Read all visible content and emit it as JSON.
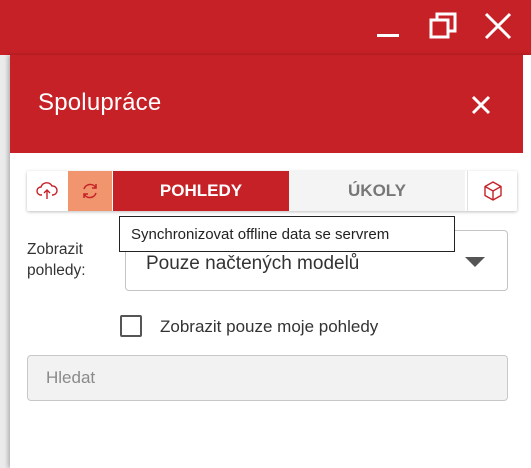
{
  "window": {
    "controls": [
      "minimize",
      "restore",
      "close"
    ]
  },
  "panel": {
    "title": "Spolupráce"
  },
  "toolbar": {
    "tabs": [
      {
        "label": "POHLEDY",
        "active": true
      },
      {
        "label": "ÚKOLY",
        "active": false
      }
    ],
    "icons": [
      "cloud-upload-icon",
      "sync-icon",
      "cube-icon"
    ]
  },
  "tooltip": {
    "text": "Synchronizovat offline data se servrem"
  },
  "filter": {
    "label": "Zobrazit pohledy:",
    "selected": "Pouze načtených modelů"
  },
  "checkbox": {
    "label": "Zobrazit pouze moje pohledy",
    "checked": false
  },
  "search": {
    "placeholder": "Hledat",
    "value": ""
  },
  "colors": {
    "brand": "#c62127",
    "sync_active": "#f0956e"
  }
}
